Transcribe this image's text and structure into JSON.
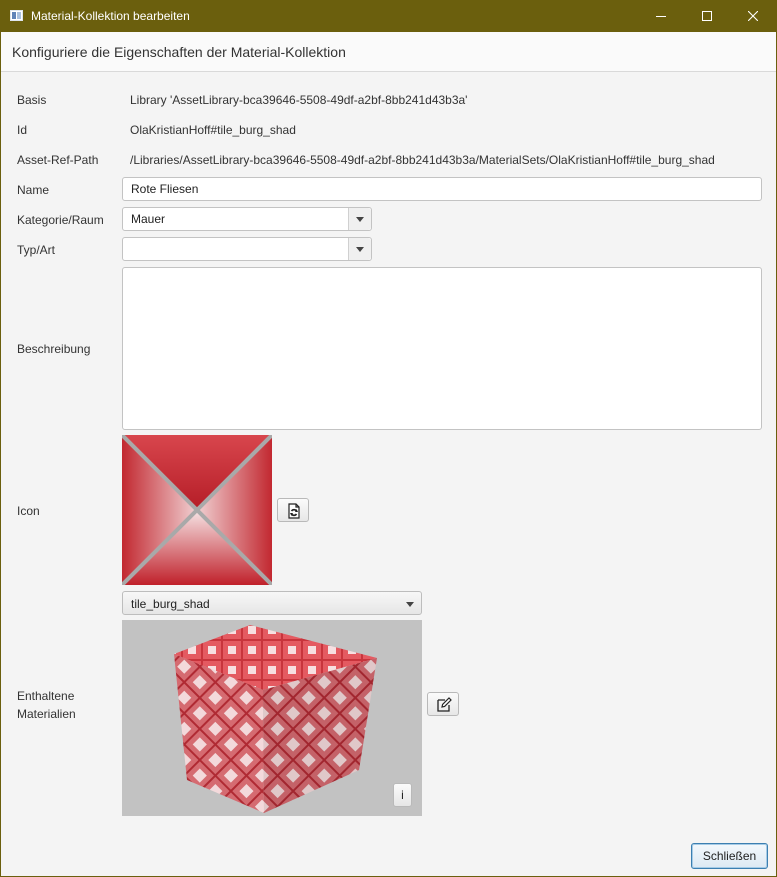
{
  "window": {
    "title": "Material-Kollektion bearbeiten",
    "header": "Konfiguriere die Eigenschaften der Material-Kollektion",
    "title_bar_color": "#6b5f0d"
  },
  "fields": {
    "basis": {
      "label": "Basis",
      "value": "Library 'AssetLibrary-bca39646-5508-49df-a2bf-8bb241d43b3a'"
    },
    "id": {
      "label": "Id",
      "value": "OlaKristianHoff#tile_burg_shad"
    },
    "asset_ref_path": {
      "label": "Asset-Ref-Path",
      "value": "/Libraries/AssetLibrary-bca39646-5508-49df-a2bf-8bb241d43b3a/MaterialSets/OlaKristianHoff#tile_burg_shad"
    },
    "name": {
      "label": "Name",
      "value": "Rote Fliesen"
    },
    "kategorie": {
      "label": "Kategorie/Raum",
      "value": "Mauer"
    },
    "typ": {
      "label": "Typ/Art",
      "value": ""
    },
    "beschreibung": {
      "label": "Beschreibung",
      "value": ""
    },
    "icon": {
      "label": "Icon"
    },
    "materialien": {
      "label_line1": "Enthaltene",
      "label_line2": "Materialien",
      "selected": "tile_burg_shad"
    }
  },
  "buttons": {
    "info": "i",
    "close": "Schließen"
  },
  "icons": {
    "app": "window-app-icon",
    "minimize": "minimize-icon",
    "maximize": "maximize-icon",
    "close": "close-icon",
    "change_icon": "refresh-file-icon",
    "edit": "edit-icon"
  },
  "colors": {
    "tile_red": "#c0202a",
    "tile_light": "#f4dfe0",
    "grout": "#aaaaaa",
    "preview_bg": "#c2c2c2",
    "default_button_border": "#3c7fb1"
  }
}
